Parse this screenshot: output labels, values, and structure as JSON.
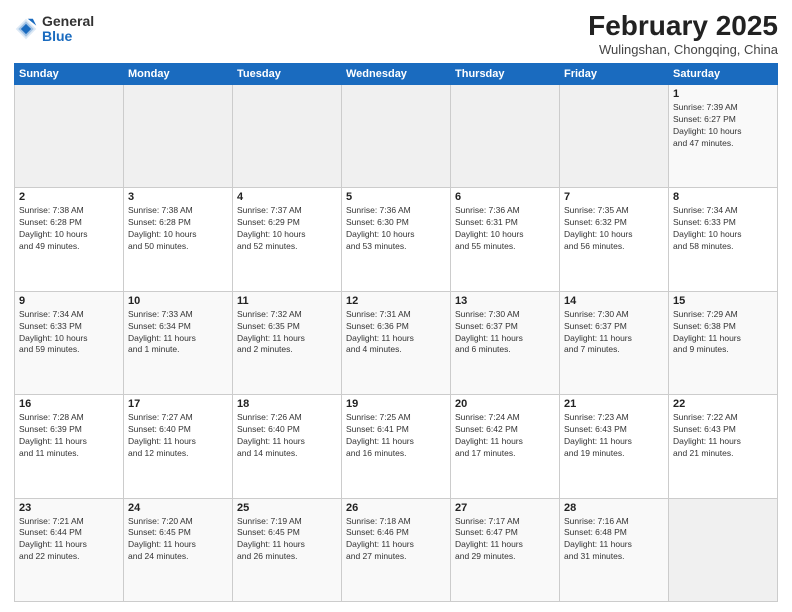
{
  "header": {
    "logo_general": "General",
    "logo_blue": "Blue",
    "month_title": "February 2025",
    "location": "Wulingshan, Chongqing, China"
  },
  "weekdays": [
    "Sunday",
    "Monday",
    "Tuesday",
    "Wednesday",
    "Thursday",
    "Friday",
    "Saturday"
  ],
  "weeks": [
    [
      {
        "day": "",
        "info": ""
      },
      {
        "day": "",
        "info": ""
      },
      {
        "day": "",
        "info": ""
      },
      {
        "day": "",
        "info": ""
      },
      {
        "day": "",
        "info": ""
      },
      {
        "day": "",
        "info": ""
      },
      {
        "day": "1",
        "info": "Sunrise: 7:39 AM\nSunset: 6:27 PM\nDaylight: 10 hours\nand 47 minutes."
      }
    ],
    [
      {
        "day": "2",
        "info": "Sunrise: 7:38 AM\nSunset: 6:28 PM\nDaylight: 10 hours\nand 49 minutes."
      },
      {
        "day": "3",
        "info": "Sunrise: 7:38 AM\nSunset: 6:28 PM\nDaylight: 10 hours\nand 50 minutes."
      },
      {
        "day": "4",
        "info": "Sunrise: 7:37 AM\nSunset: 6:29 PM\nDaylight: 10 hours\nand 52 minutes."
      },
      {
        "day": "5",
        "info": "Sunrise: 7:36 AM\nSunset: 6:30 PM\nDaylight: 10 hours\nand 53 minutes."
      },
      {
        "day": "6",
        "info": "Sunrise: 7:36 AM\nSunset: 6:31 PM\nDaylight: 10 hours\nand 55 minutes."
      },
      {
        "day": "7",
        "info": "Sunrise: 7:35 AM\nSunset: 6:32 PM\nDaylight: 10 hours\nand 56 minutes."
      },
      {
        "day": "8",
        "info": "Sunrise: 7:34 AM\nSunset: 6:33 PM\nDaylight: 10 hours\nand 58 minutes."
      }
    ],
    [
      {
        "day": "9",
        "info": "Sunrise: 7:34 AM\nSunset: 6:33 PM\nDaylight: 10 hours\nand 59 minutes."
      },
      {
        "day": "10",
        "info": "Sunrise: 7:33 AM\nSunset: 6:34 PM\nDaylight: 11 hours\nand 1 minute."
      },
      {
        "day": "11",
        "info": "Sunrise: 7:32 AM\nSunset: 6:35 PM\nDaylight: 11 hours\nand 2 minutes."
      },
      {
        "day": "12",
        "info": "Sunrise: 7:31 AM\nSunset: 6:36 PM\nDaylight: 11 hours\nand 4 minutes."
      },
      {
        "day": "13",
        "info": "Sunrise: 7:30 AM\nSunset: 6:37 PM\nDaylight: 11 hours\nand 6 minutes."
      },
      {
        "day": "14",
        "info": "Sunrise: 7:30 AM\nSunset: 6:37 PM\nDaylight: 11 hours\nand 7 minutes."
      },
      {
        "day": "15",
        "info": "Sunrise: 7:29 AM\nSunset: 6:38 PM\nDaylight: 11 hours\nand 9 minutes."
      }
    ],
    [
      {
        "day": "16",
        "info": "Sunrise: 7:28 AM\nSunset: 6:39 PM\nDaylight: 11 hours\nand 11 minutes."
      },
      {
        "day": "17",
        "info": "Sunrise: 7:27 AM\nSunset: 6:40 PM\nDaylight: 11 hours\nand 12 minutes."
      },
      {
        "day": "18",
        "info": "Sunrise: 7:26 AM\nSunset: 6:40 PM\nDaylight: 11 hours\nand 14 minutes."
      },
      {
        "day": "19",
        "info": "Sunrise: 7:25 AM\nSunset: 6:41 PM\nDaylight: 11 hours\nand 16 minutes."
      },
      {
        "day": "20",
        "info": "Sunrise: 7:24 AM\nSunset: 6:42 PM\nDaylight: 11 hours\nand 17 minutes."
      },
      {
        "day": "21",
        "info": "Sunrise: 7:23 AM\nSunset: 6:43 PM\nDaylight: 11 hours\nand 19 minutes."
      },
      {
        "day": "22",
        "info": "Sunrise: 7:22 AM\nSunset: 6:43 PM\nDaylight: 11 hours\nand 21 minutes."
      }
    ],
    [
      {
        "day": "23",
        "info": "Sunrise: 7:21 AM\nSunset: 6:44 PM\nDaylight: 11 hours\nand 22 minutes."
      },
      {
        "day": "24",
        "info": "Sunrise: 7:20 AM\nSunset: 6:45 PM\nDaylight: 11 hours\nand 24 minutes."
      },
      {
        "day": "25",
        "info": "Sunrise: 7:19 AM\nSunset: 6:45 PM\nDaylight: 11 hours\nand 26 minutes."
      },
      {
        "day": "26",
        "info": "Sunrise: 7:18 AM\nSunset: 6:46 PM\nDaylight: 11 hours\nand 27 minutes."
      },
      {
        "day": "27",
        "info": "Sunrise: 7:17 AM\nSunset: 6:47 PM\nDaylight: 11 hours\nand 29 minutes."
      },
      {
        "day": "28",
        "info": "Sunrise: 7:16 AM\nSunset: 6:48 PM\nDaylight: 11 hours\nand 31 minutes."
      },
      {
        "day": "",
        "info": ""
      }
    ]
  ]
}
